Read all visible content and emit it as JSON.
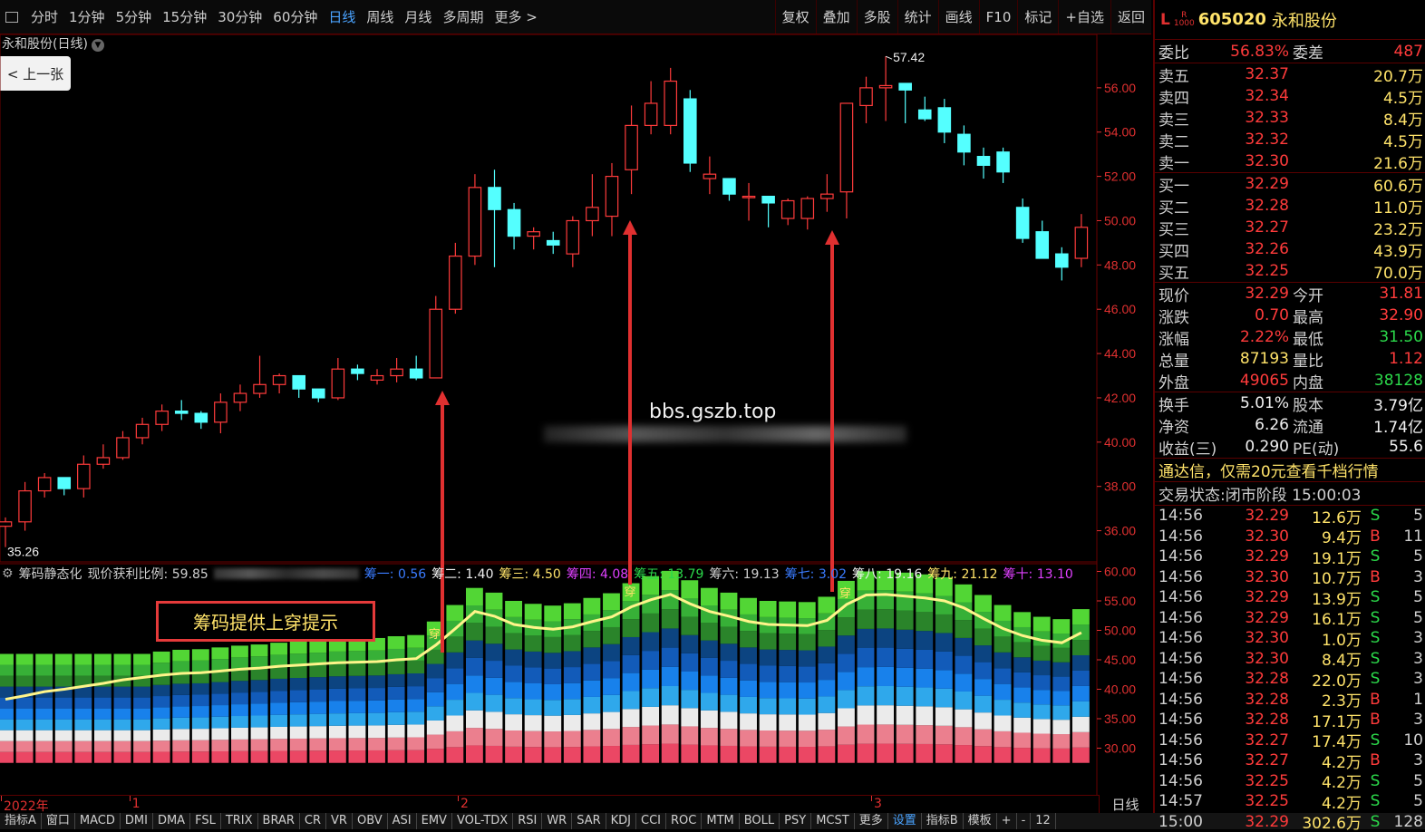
{
  "topbar": {
    "periods": [
      "分时",
      "1分钟",
      "5分钟",
      "15分钟",
      "30分钟",
      "60分钟",
      "日线",
      "周线",
      "月线",
      "多周期",
      "更多 >"
    ],
    "active_period": "日线",
    "tools": [
      "复权",
      "叠加",
      "多股",
      "统计",
      "画线",
      "F10",
      "标记",
      "+自选",
      "返回"
    ]
  },
  "chart_title": "永和股份(日线)",
  "prev_button": "< 上一张",
  "watermark_url": "bbs.gszb.top",
  "notice_text": "筹码提供上穿提示",
  "indicator_legend": {
    "name": "筹码静态化",
    "profit_label": "现价获利比例: 59.85",
    "items": [
      {
        "text": "筹一: 0.56",
        "color": "#3a7bff"
      },
      {
        "text": "筹二: 1.40",
        "color": "#f0f0f0"
      },
      {
        "text": "筹三: 4.50",
        "color": "#ffe36a"
      },
      {
        "text": "筹四: 4.08",
        "color": "#e040ff"
      },
      {
        "text": "筹五: 13.79",
        "color": "#2bd84a"
      },
      {
        "text": "筹六: 19.13",
        "color": "#cfcfcf"
      },
      {
        "text": "筹七: 3.02",
        "color": "#3a7bff"
      },
      {
        "text": "筹八: 19.16",
        "color": "#f0f0f0"
      },
      {
        "text": "筹九: 21.12",
        "color": "#ffe36a"
      },
      {
        "text": "筹十: 13.10",
        "color": "#e040ff"
      }
    ]
  },
  "price_axis": [
    "56.00",
    "54.00",
    "52.00",
    "50.00",
    "48.00",
    "46.00",
    "44.00",
    "42.00",
    "40.00",
    "38.00",
    "36.00"
  ],
  "ind_axis": [
    "60.00",
    "55.00",
    "50.00",
    "45.00",
    "40.00",
    "35.00",
    "30.00"
  ],
  "price_high_label": "57.42",
  "price_low_label": "35.26",
  "cross_label": "穿",
  "date_axis": [
    {
      "text": "2022年",
      "pos": 0.0
    },
    {
      "text": "1",
      "pos": 0.118
    },
    {
      "text": "2",
      "pos": 0.42
    },
    {
      "text": "3",
      "pos": 0.8
    }
  ],
  "daily_label": "日线",
  "bottom_tabs": [
    "指标A",
    "窗口",
    "MACD",
    "DMI",
    "DMA",
    "FSL",
    "TRIX",
    "BRAR",
    "CR",
    "VR",
    "OBV",
    "ASI",
    "EMV",
    "VOL-TDX",
    "RSI",
    "WR",
    "SAR",
    "KDJ",
    "CCI",
    "ROC",
    "MTM",
    "BOLL",
    "PSY",
    "MCST",
    "更多",
    "设置",
    "指标B",
    "模板",
    "+",
    "-",
    "12"
  ],
  "active_tab": "设置",
  "chart_data": {
    "type": "candlestick",
    "ylim": [
      35,
      58
    ],
    "candles": [
      [
        36.2,
        36.6,
        35.26,
        36.4
      ],
      [
        36.4,
        38.2,
        36.0,
        37.8
      ],
      [
        37.8,
        38.6,
        37.5,
        38.4
      ],
      [
        38.4,
        38.3,
        37.6,
        37.9
      ],
      [
        37.9,
        39.4,
        37.5,
        39.0
      ],
      [
        39.0,
        39.9,
        38.8,
        39.3
      ],
      [
        39.3,
        40.5,
        39.2,
        40.2
      ],
      [
        40.2,
        41.1,
        39.9,
        40.8
      ],
      [
        40.8,
        41.7,
        40.5,
        41.4
      ],
      [
        41.4,
        41.9,
        41.0,
        41.3
      ],
      [
        41.3,
        41.4,
        40.6,
        40.9
      ],
      [
        40.9,
        42.2,
        40.4,
        41.8
      ],
      [
        41.8,
        42.6,
        41.4,
        42.2
      ],
      [
        42.2,
        43.9,
        42.0,
        42.6
      ],
      [
        42.6,
        43.1,
        42.2,
        43.0
      ],
      [
        43.0,
        42.8,
        42.0,
        42.4
      ],
      [
        42.4,
        42.4,
        41.8,
        42.0
      ],
      [
        42.0,
        43.8,
        41.9,
        43.3
      ],
      [
        43.3,
        43.5,
        42.8,
        43.1
      ],
      [
        42.8,
        43.3,
        42.6,
        43.0
      ],
      [
        43.0,
        43.8,
        42.7,
        43.3
      ],
      [
        43.3,
        43.9,
        42.8,
        42.9
      ],
      [
        42.9,
        46.6,
        42.9,
        46.0
      ],
      [
        46.0,
        49.0,
        45.8,
        48.4
      ],
      [
        48.4,
        52.1,
        48.0,
        51.5
      ],
      [
        51.5,
        52.3,
        47.9,
        50.5
      ],
      [
        50.5,
        50.8,
        48.7,
        49.3
      ],
      [
        49.3,
        49.7,
        48.7,
        49.5
      ],
      [
        49.1,
        49.5,
        48.5,
        48.9
      ],
      [
        48.5,
        50.2,
        47.9,
        50.0
      ],
      [
        50.0,
        52.1,
        49.3,
        50.6
      ],
      [
        50.2,
        52.6,
        49.3,
        52.0
      ],
      [
        52.3,
        55.2,
        51.2,
        54.3
      ],
      [
        54.3,
        56.3,
        53.9,
        55.3
      ],
      [
        54.3,
        56.9,
        53.9,
        56.3
      ],
      [
        55.5,
        55.9,
        52.2,
        52.6
      ],
      [
        51.9,
        52.9,
        51.2,
        52.1
      ],
      [
        51.9,
        51.9,
        50.9,
        51.2
      ],
      [
        51.1,
        51.7,
        50.0,
        51.1
      ],
      [
        51.1,
        51.1,
        49.7,
        50.8
      ],
      [
        50.1,
        51.0,
        49.8,
        50.9
      ],
      [
        50.1,
        51.1,
        49.6,
        51.0
      ],
      [
        51.0,
        52.1,
        50.4,
        51.2
      ],
      [
        51.3,
        55.0,
        50.1,
        55.3
      ],
      [
        55.2,
        56.5,
        54.4,
        56.0
      ],
      [
        56.0,
        57.42,
        54.5,
        56.1
      ],
      [
        56.2,
        56.1,
        54.4,
        55.9
      ],
      [
        55.0,
        55.6,
        54.5,
        54.6
      ],
      [
        55.1,
        55.5,
        53.5,
        54.0
      ],
      [
        53.9,
        54.3,
        52.5,
        53.1
      ],
      [
        52.9,
        53.3,
        51.9,
        52.5
      ],
      [
        53.1,
        53.3,
        51.7,
        52.2
      ],
      [
        50.6,
        51.0,
        49.0,
        49.2
      ],
      [
        49.5,
        50.0,
        48.5,
        48.3
      ],
      [
        48.5,
        48.8,
        47.3,
        47.9
      ],
      [
        48.3,
        50.3,
        47.9,
        49.7
      ]
    ],
    "chip_line": [
      38.3,
      38.9,
      39.6,
      40.0,
      40.5,
      41.0,
      41.6,
      42.0,
      42.4,
      42.7,
      42.8,
      43.1,
      43.4,
      43.6,
      43.9,
      44.1,
      44.3,
      44.5,
      44.6,
      44.7,
      45.0,
      45.2,
      47.5,
      50.3,
      53.2,
      52.4,
      51.0,
      50.5,
      50.2,
      50.6,
      51.5,
      52.3,
      54.0,
      55.2,
      56.1,
      54.5,
      53.2,
      52.4,
      51.5,
      51.0,
      50.9,
      50.8,
      51.7,
      54.4,
      56.0,
      56.1,
      55.8,
      55.5,
      55.0,
      53.8,
      52.0,
      50.3,
      49.1,
      48.3,
      47.9,
      49.6
    ],
    "ind_ylim": [
      25,
      61
    ]
  },
  "quote": {
    "badge_L": "L",
    "badge_R": "R",
    "badge_num": "1000",
    "code": "605020",
    "name": "永和股份",
    "weibi_label": "委比",
    "weibi": "56.83%",
    "weicha_label": "委差",
    "weicha": "487",
    "asks": [
      {
        "label": "卖五",
        "price": "32.37",
        "vol": "20.7万"
      },
      {
        "label": "卖四",
        "price": "32.34",
        "vol": "4.5万"
      },
      {
        "label": "卖三",
        "price": "32.33",
        "vol": "8.4万"
      },
      {
        "label": "卖二",
        "price": "32.32",
        "vol": "4.5万"
      },
      {
        "label": "卖一",
        "price": "32.30",
        "vol": "21.6万"
      }
    ],
    "bids": [
      {
        "label": "买一",
        "price": "32.29",
        "vol": "60.6万"
      },
      {
        "label": "买二",
        "price": "32.28",
        "vol": "11.0万"
      },
      {
        "label": "买三",
        "price": "32.27",
        "vol": "23.2万"
      },
      {
        "label": "买四",
        "price": "32.26",
        "vol": "43.9万"
      },
      {
        "label": "买五",
        "price": "32.25",
        "vol": "70.0万"
      }
    ],
    "stats": [
      {
        "l1": "现价",
        "v1": "32.29",
        "c1": "red",
        "l2": "今开",
        "v2": "31.81",
        "c2": "red"
      },
      {
        "l1": "涨跌",
        "v1": "0.70",
        "c1": "red",
        "l2": "最高",
        "v2": "32.90",
        "c2": "red"
      },
      {
        "l1": "涨幅",
        "v1": "2.22%",
        "c1": "red",
        "l2": "最低",
        "v2": "31.50",
        "c2": "green"
      },
      {
        "l1": "总量",
        "v1": "87193",
        "c1": "yellow",
        "l2": "量比",
        "v2": "1.12",
        "c2": "red"
      },
      {
        "l1": "外盘",
        "v1": "49065",
        "c1": "red",
        "l2": "内盘",
        "v2": "38128",
        "c2": "green"
      }
    ],
    "stats2": [
      {
        "l1": "换手",
        "v1": "5.01%",
        "l2": "股本",
        "v2": "3.79亿"
      },
      {
        "l1": "净资",
        "v1": "6.26",
        "l2": "流通",
        "v2": "1.74亿"
      },
      {
        "l1": "收益(三)",
        "v1": "0.290",
        "l2": "PE(动)",
        "v2": "55.6"
      }
    ],
    "promo": "通达信，仅需20元查看千档行情",
    "status_label": "交易状态:",
    "status_value": "闭市阶段 15:00:03",
    "ticks": [
      {
        "t": "14:56",
        "p": "32.29",
        "pc": "red",
        "v": "12.6万",
        "f": "S",
        "n": "5"
      },
      {
        "t": "14:56",
        "p": "32.30",
        "pc": "red",
        "v": "9.4万",
        "f": "B",
        "n": "11"
      },
      {
        "t": "14:56",
        "p": "32.29",
        "pc": "red",
        "v": "19.1万",
        "f": "S",
        "n": "5"
      },
      {
        "t": "14:56",
        "p": "32.30",
        "pc": "red",
        "v": "10.7万",
        "f": "B",
        "n": "3"
      },
      {
        "t": "14:56",
        "p": "32.29",
        "pc": "red",
        "v": "13.9万",
        "f": "S",
        "n": "5"
      },
      {
        "t": "14:56",
        "p": "32.29",
        "pc": "red",
        "v": "16.1万",
        "f": "S",
        "n": "5"
      },
      {
        "t": "14:56",
        "p": "32.30",
        "pc": "red",
        "v": "1.0万",
        "f": "S",
        "n": "3"
      },
      {
        "t": "14:56",
        "p": "32.30",
        "pc": "red",
        "v": "8.4万",
        "f": "S",
        "n": "3"
      },
      {
        "t": "14:56",
        "p": "32.28",
        "pc": "red",
        "v": "22.0万",
        "f": "S",
        "n": "3"
      },
      {
        "t": "14:56",
        "p": "32.28",
        "pc": "red",
        "v": "2.3万",
        "f": "B",
        "n": "1"
      },
      {
        "t": "14:56",
        "p": "32.28",
        "pc": "red",
        "v": "17.1万",
        "f": "B",
        "n": "3"
      },
      {
        "t": "14:56",
        "p": "32.27",
        "pc": "red",
        "v": "17.4万",
        "f": "S",
        "n": "10"
      },
      {
        "t": "14:56",
        "p": "32.27",
        "pc": "red",
        "v": "4.2万",
        "f": "B",
        "n": "3"
      },
      {
        "t": "14:56",
        "p": "32.25",
        "pc": "red",
        "v": "4.2万",
        "f": "S",
        "n": "5"
      },
      {
        "t": "14:57",
        "p": "32.25",
        "pc": "red",
        "v": "4.2万",
        "f": "S",
        "n": "5"
      },
      {
        "t": "15:00",
        "p": "32.29",
        "pc": "red",
        "v": "302.6万",
        "f": "S",
        "n": "128"
      }
    ]
  }
}
